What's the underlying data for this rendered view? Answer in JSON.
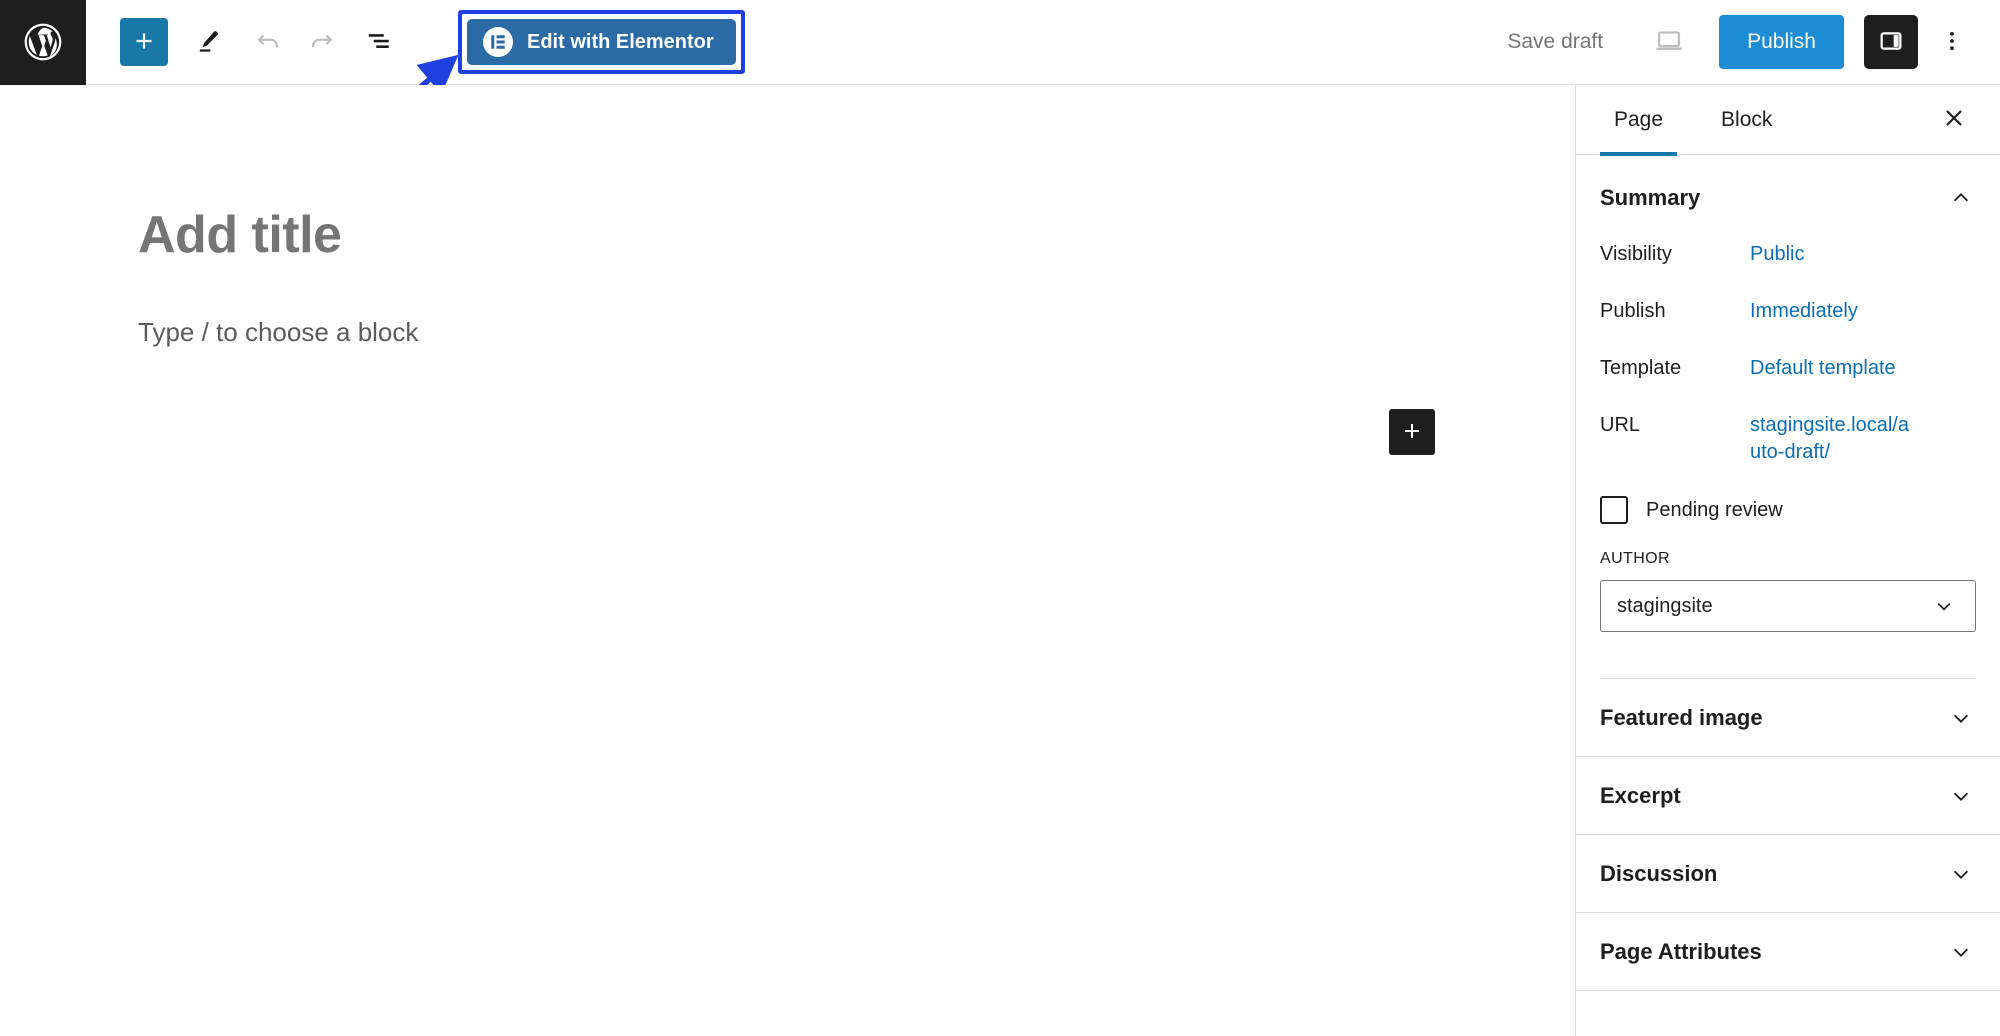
{
  "toolbar": {
    "wordpress_logo_icon": "wordpress-logo",
    "add_block_icon": "plus-icon",
    "tools_icon": "pencil-icon",
    "undo_icon": "undo-arrow-icon",
    "redo_icon": "redo-arrow-icon",
    "list_view_icon": "list-view-icon",
    "elementor_button_label": "Edit with Elementor",
    "elementor_mark_icon": "elementor-logo-icon",
    "save_draft_label": "Save draft",
    "preview_icon": "laptop-preview-icon",
    "publish_label": "Publish",
    "settings_toggle_icon": "sidebar-panel-icon",
    "more_options_icon": "kebab-menu-icon",
    "accent_blue": "#1878a8",
    "publish_blue": "#1c8dd4",
    "elementor_blue": "#2a6aa5",
    "highlight_border": "#1f3fe0"
  },
  "canvas": {
    "title_placeholder": "Add title",
    "block_placeholder": "Type / to choose a block",
    "inserter_icon": "plus-icon"
  },
  "sidebar": {
    "tabs": [
      {
        "label": "Page",
        "active": true
      },
      {
        "label": "Block",
        "active": false
      }
    ],
    "close_icon": "close-x-icon",
    "summary": {
      "title": "Summary",
      "collapse_icon": "chevron-up-icon",
      "rows": [
        {
          "label": "Visibility",
          "value": "Public"
        },
        {
          "label": "Publish",
          "value": "Immediately"
        },
        {
          "label": "Template",
          "value": "Default template"
        },
        {
          "label": "URL",
          "value": "stagingsite.local/auto-draft/"
        }
      ],
      "pending_review_label": "Pending review",
      "pending_review_checked": false,
      "author_label": "AUTHOR",
      "author_value": "stagingsite",
      "author_dropdown_icon": "chevron-down-icon"
    },
    "panels": [
      {
        "label": "Featured image",
        "icon": "chevron-down-icon"
      },
      {
        "label": "Excerpt",
        "icon": "chevron-down-icon"
      },
      {
        "label": "Discussion",
        "icon": "chevron-down-icon"
      },
      {
        "label": "Page Attributes",
        "icon": "chevron-down-icon"
      }
    ]
  },
  "annotation": {
    "arrow_icon": "annotation-arrow-icon",
    "color": "#1f3fe0"
  }
}
